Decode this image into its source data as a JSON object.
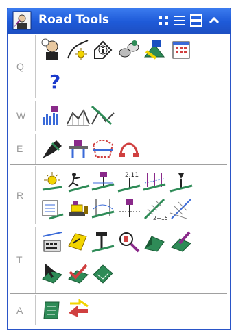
{
  "window": {
    "title": "Road Tools"
  },
  "titlebar_buttons": [
    "grid-view-icon",
    "list-view-icon",
    "dock-view-icon",
    "collapse-chevron-icon"
  ],
  "groups": [
    {
      "key": "Q",
      "tools": [
        "customize-user-icon",
        "sun-alignment-icon",
        "info-tool-icon",
        "link-gear-icon",
        "export-tool-icon",
        "calendar-grid-icon",
        "help-question-icon"
      ]
    },
    {
      "key": "W",
      "tools": [
        "bar-profile-icon",
        "profile-grid-icon",
        "profile-line-icon"
      ]
    },
    {
      "key": "E",
      "tools": [
        "pen-tool-icon",
        "bridge-section-icon",
        "template-shape-icon",
        "red-arc-icon"
      ]
    },
    {
      "key": "R",
      "tools": [
        "sun-surface-icon",
        "run-figure-icon",
        "pipe-surface-icon",
        "label-2-11-icon",
        "multi-surface-icon",
        "elevation-marker-icon",
        "report-sheet-icon",
        "bulldozer-icon",
        "vertical-curve-icon",
        "cross-point-icon",
        "station-2-15-icon",
        "cross-lines-icon"
      ]
    },
    {
      "key": "T",
      "tools": [
        "keyboard-table-icon",
        "road-puzzle-icon",
        "hammer-pin-icon",
        "zoom-inspect-icon",
        "ramp-block-icon",
        "brush-sheet-icon",
        "cursor-sheet-icon",
        "checkmark-sheet-icon",
        "flat-plane-icon"
      ]
    },
    {
      "key": "A",
      "tools": [
        "notebook-icon",
        "swap-arrows-icon"
      ]
    }
  ],
  "colors": {
    "titlebar": "#1e5ad8",
    "border": "#2a55c8",
    "accent_green": "#2e8b57",
    "accent_purple": "#8a2a8a"
  }
}
